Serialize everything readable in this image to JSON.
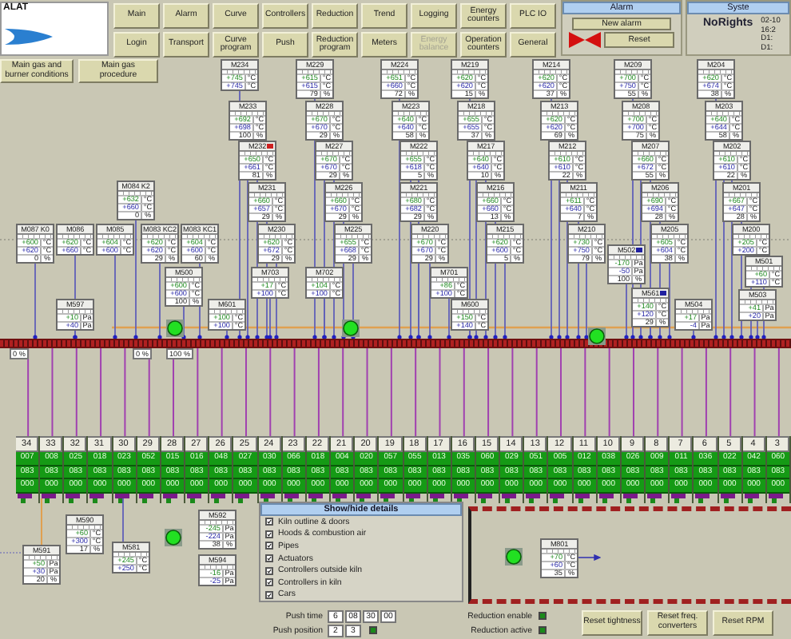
{
  "logo": {
    "text": "ALAT"
  },
  "nav": [
    {
      "label": "Main",
      "disabled": false
    },
    {
      "label": "Alarm",
      "disabled": false
    },
    {
      "label": "Curve",
      "disabled": false
    },
    {
      "label": "Controllers",
      "disabled": false
    },
    {
      "label": "Reduction",
      "disabled": false
    },
    {
      "label": "Trend",
      "disabled": false
    },
    {
      "label": "Logging",
      "disabled": false
    },
    {
      "label": "Energy counters",
      "disabled": false
    },
    {
      "label": "PLC IO",
      "disabled": false
    },
    {
      "label": "Login",
      "disabled": false
    },
    {
      "label": "Transport",
      "disabled": false
    },
    {
      "label": "Curve program",
      "disabled": false
    },
    {
      "label": "Push",
      "disabled": false
    },
    {
      "label": "Reduction program",
      "disabled": false
    },
    {
      "label": "Meters",
      "disabled": false
    },
    {
      "label": "Energy balance",
      "disabled": true
    },
    {
      "label": "Operation counters",
      "disabled": false
    },
    {
      "label": "General",
      "disabled": false
    }
  ],
  "alarm": {
    "title": "Alarm",
    "new_alarm": "New alarm",
    "reset": "Reset"
  },
  "system": {
    "title": "Syste",
    "user": "NoRights",
    "lines": [
      "02-10",
      "16:2",
      "D1:",
      "D1:"
    ]
  },
  "gas_buttons": [
    "Main gas and burner conditions",
    "Main gas procedure"
  ],
  "controllers": [
    {
      "name": "M234",
      "rows": [
        {
          "value": "+745",
          "unit": "°C"
        },
        {
          "value": "+745",
          "unit": "°C"
        }
      ]
    },
    {
      "name": "M229",
      "rows": [
        {
          "value": "+615",
          "unit": "°C"
        },
        {
          "value": "+615",
          "unit": "°C"
        },
        {
          "value": "79",
          "unit": "%"
        }
      ]
    },
    {
      "name": "M224",
      "rows": [
        {
          "value": "+651",
          "unit": "°C"
        },
        {
          "value": "+660",
          "unit": "°C"
        },
        {
          "value": "72",
          "unit": "%"
        }
      ]
    },
    {
      "name": "M219",
      "rows": [
        {
          "value": "+620",
          "unit": "°C"
        },
        {
          "value": "+620",
          "unit": "°C"
        },
        {
          "value": "15",
          "unit": "%"
        }
      ]
    },
    {
      "name": "M214",
      "rows": [
        {
          "value": "+620",
          "unit": "°C"
        },
        {
          "value": "+620",
          "unit": "°C"
        },
        {
          "value": "37",
          "unit": "%"
        }
      ]
    },
    {
      "name": "M209",
      "rows": [
        {
          "value": "+700",
          "unit": "°C"
        },
        {
          "value": "+750",
          "unit": "°C"
        },
        {
          "value": "55",
          "unit": "%"
        }
      ]
    },
    {
      "name": "M204",
      "rows": [
        {
          "value": "+620",
          "unit": "°C"
        },
        {
          "value": "+674",
          "unit": "°C"
        },
        {
          "value": "38",
          "unit": "%"
        }
      ]
    },
    {
      "name": "M233",
      "rows": [
        {
          "value": "+692",
          "unit": "°C"
        },
        {
          "value": "+698",
          "unit": "°C"
        },
        {
          "value": "100",
          "unit": "%"
        }
      ]
    },
    {
      "name": "M228",
      "rows": [
        {
          "value": "+670",
          "unit": "°C"
        },
        {
          "value": "+670",
          "unit": "°C"
        },
        {
          "value": "29",
          "unit": "%"
        }
      ]
    },
    {
      "name": "M223",
      "rows": [
        {
          "value": "+640",
          "unit": "°C"
        },
        {
          "value": "+640",
          "unit": "°C"
        },
        {
          "value": "58",
          "unit": "%"
        }
      ]
    },
    {
      "name": "M218",
      "rows": [
        {
          "value": "+655",
          "unit": "°C"
        },
        {
          "value": "+655",
          "unit": "°C"
        },
        {
          "value": "37",
          "unit": "%"
        }
      ]
    },
    {
      "name": "M213",
      "rows": [
        {
          "value": "+620",
          "unit": "°C"
        },
        {
          "value": "+620",
          "unit": "°C"
        },
        {
          "value": "69",
          "unit": "%"
        }
      ]
    },
    {
      "name": "M208",
      "rows": [
        {
          "value": "+700",
          "unit": "°C"
        },
        {
          "value": "+700",
          "unit": "°C"
        },
        {
          "value": "75",
          "unit": "%"
        }
      ]
    },
    {
      "name": "M203",
      "rows": [
        {
          "value": "+640",
          "unit": "°C"
        },
        {
          "value": "+644",
          "unit": "°C"
        },
        {
          "value": "58",
          "unit": "%"
        }
      ]
    },
    {
      "name": "M232",
      "color": "#cc2020",
      "rows": [
        {
          "value": "+650",
          "unit": "°C"
        },
        {
          "value": "+661",
          "unit": "°C"
        },
        {
          "value": "81",
          "unit": "%"
        }
      ]
    },
    {
      "name": "M227",
      "rows": [
        {
          "value": "+670",
          "unit": "°C"
        },
        {
          "value": "+670",
          "unit": "°C"
        },
        {
          "value": "29",
          "unit": "%"
        }
      ]
    },
    {
      "name": "M222",
      "rows": [
        {
          "value": "+655",
          "unit": "°C"
        },
        {
          "value": "+618",
          "unit": "°C"
        },
        {
          "value": "5",
          "unit": "%"
        }
      ]
    },
    {
      "name": "M217",
      "rows": [
        {
          "value": "+640",
          "unit": "°C"
        },
        {
          "value": "+640",
          "unit": "°C"
        },
        {
          "value": "10",
          "unit": "%"
        }
      ]
    },
    {
      "name": "M212",
      "rows": [
        {
          "value": "+610",
          "unit": "°C"
        },
        {
          "value": "+610",
          "unit": "°C"
        },
        {
          "value": "22",
          "unit": "%"
        }
      ]
    },
    {
      "name": "M207",
      "rows": [
        {
          "value": "+660",
          "unit": "°C"
        },
        {
          "value": "+672",
          "unit": "°C"
        },
        {
          "value": "55",
          "unit": "%"
        }
      ]
    },
    {
      "name": "M202",
      "rows": [
        {
          "value": "+610",
          "unit": "°C"
        },
        {
          "value": "+610",
          "unit": "°C"
        },
        {
          "value": "22",
          "unit": "%"
        }
      ]
    },
    {
      "name": "M084 K2",
      "rows": [
        {
          "value": "+632",
          "unit": "°C"
        },
        {
          "value": "+660",
          "unit": "°C"
        },
        {
          "value": "0",
          "unit": "%"
        }
      ]
    },
    {
      "name": "M231",
      "rows": [
        {
          "value": "+660",
          "unit": "°C"
        },
        {
          "value": "+657",
          "unit": "°C"
        },
        {
          "value": "29",
          "unit": "%"
        }
      ]
    },
    {
      "name": "M226",
      "rows": [
        {
          "value": "+660",
          "unit": "°C"
        },
        {
          "value": "+670",
          "unit": "°C"
        },
        {
          "value": "29",
          "unit": "%"
        }
      ]
    },
    {
      "name": "M221",
      "rows": [
        {
          "value": "+680",
          "unit": "°C"
        },
        {
          "value": "+682",
          "unit": "°C"
        },
        {
          "value": "29",
          "unit": "%"
        }
      ]
    },
    {
      "name": "M216",
      "rows": [
        {
          "value": "+660",
          "unit": "°C"
        },
        {
          "value": "+660",
          "unit": "°C"
        },
        {
          "value": "13",
          "unit": "%"
        }
      ]
    },
    {
      "name": "M211",
      "rows": [
        {
          "value": "+611",
          "unit": "°C"
        },
        {
          "value": "+640",
          "unit": "°C"
        },
        {
          "value": "7",
          "unit": "%"
        }
      ]
    },
    {
      "name": "M206",
      "rows": [
        {
          "value": "+690",
          "unit": "°C"
        },
        {
          "value": "+694",
          "unit": "°C"
        },
        {
          "value": "28",
          "unit": "%"
        }
      ]
    },
    {
      "name": "M201",
      "rows": [
        {
          "value": "+667",
          "unit": "°C"
        },
        {
          "value": "+647",
          "unit": "°C"
        },
        {
          "value": "28",
          "unit": "%"
        }
      ]
    },
    {
      "name": "M087 K0",
      "rows": [
        {
          "value": "+600",
          "unit": "°C"
        },
        {
          "value": "+620",
          "unit": "°C"
        },
        {
          "value": "0",
          "unit": "%"
        }
      ]
    },
    {
      "name": "M086",
      "rows": [
        {
          "value": "+620",
          "unit": "°C"
        },
        {
          "value": "+660",
          "unit": "°C"
        }
      ]
    },
    {
      "name": "M085",
      "rows": [
        {
          "value": "+604",
          "unit": "°C"
        },
        {
          "value": "+600",
          "unit": "°C"
        }
      ]
    },
    {
      "name": "M083 KC2",
      "rows": [
        {
          "value": "+620",
          "unit": "°C"
        },
        {
          "value": "+620",
          "unit": "°C"
        },
        {
          "value": "29",
          "unit": "%"
        }
      ]
    },
    {
      "name": "M083 KC1",
      "rows": [
        {
          "value": "+604",
          "unit": "°C"
        },
        {
          "value": "+600",
          "unit": "°C"
        },
        {
          "value": "60",
          "unit": "%"
        }
      ]
    },
    {
      "name": "M230",
      "rows": [
        {
          "value": "+620",
          "unit": "°C"
        },
        {
          "value": "+672",
          "unit": "°C"
        },
        {
          "value": "29",
          "unit": "%"
        }
      ]
    },
    {
      "name": "M225",
      "rows": [
        {
          "value": "+655",
          "unit": "°C"
        },
        {
          "value": "+668",
          "unit": "°C"
        },
        {
          "value": "29",
          "unit": "%"
        }
      ]
    },
    {
      "name": "M220",
      "rows": [
        {
          "value": "+670",
          "unit": "°C"
        },
        {
          "value": "+670",
          "unit": "°C"
        },
        {
          "value": "29",
          "unit": "%"
        }
      ]
    },
    {
      "name": "M215",
      "rows": [
        {
          "value": "+620",
          "unit": "°C"
        },
        {
          "value": "+600",
          "unit": "°C"
        },
        {
          "value": "5",
          "unit": "%"
        }
      ]
    },
    {
      "name": "M210",
      "rows": [
        {
          "value": "+730",
          "unit": "°C"
        },
        {
          "value": "+750",
          "unit": "°C"
        },
        {
          "value": "79",
          "unit": "%"
        }
      ]
    },
    {
      "name": "M205",
      "rows": [
        {
          "value": "+605",
          "unit": "°C"
        },
        {
          "value": "+604",
          "unit": "°C"
        },
        {
          "value": "38",
          "unit": "%"
        }
      ]
    },
    {
      "name": "M200",
      "rows": [
        {
          "value": "+205",
          "unit": "°C"
        },
        {
          "value": "+200",
          "unit": "°C"
        }
      ]
    },
    {
      "name": "M502",
      "color": "#2020a0",
      "rows": [
        {
          "value": "-170",
          "unit": "Pa"
        },
        {
          "value": "-50",
          "unit": "Pa"
        },
        {
          "value": "100",
          "unit": "%"
        }
      ]
    },
    {
      "name": "M501",
      "rows": [
        {
          "value": "+60",
          "unit": "°C"
        },
        {
          "value": "+110",
          "unit": "°C"
        }
      ]
    },
    {
      "name": "M500",
      "rows": [
        {
          "value": "+600",
          "unit": "°C"
        },
        {
          "value": "+600",
          "unit": "°C"
        },
        {
          "value": "100",
          "unit": "%"
        }
      ]
    },
    {
      "name": "M703",
      "rows": [
        {
          "value": "+17",
          "unit": "°C"
        },
        {
          "value": "+100",
          "unit": "°C"
        }
      ]
    },
    {
      "name": "M702",
      "rows": [
        {
          "value": "+104",
          "unit": "°C"
        },
        {
          "value": "+100",
          "unit": "°C"
        }
      ]
    },
    {
      "name": "M701",
      "rows": [
        {
          "value": "+86",
          "unit": "°C"
        },
        {
          "value": "+100",
          "unit": "°C"
        }
      ]
    },
    {
      "name": "M561",
      "color": "#2020a0",
      "rows": [
        {
          "value": "+140",
          "unit": "°C"
        },
        {
          "value": "+120",
          "unit": "°C"
        },
        {
          "value": "29",
          "unit": "%"
        }
      ]
    },
    {
      "name": "M503",
      "rows": [
        {
          "value": "+41",
          "unit": "Pa"
        },
        {
          "value": "+20",
          "unit": "Pa"
        }
      ]
    },
    {
      "name": "M597",
      "rows": [
        {
          "value": "+10",
          "unit": "Pa"
        },
        {
          "value": "+40",
          "unit": "Pa"
        }
      ]
    },
    {
      "name": "M601",
      "rows": [
        {
          "value": "+100",
          "unit": "°C"
        },
        {
          "value": "+100",
          "unit": "°C"
        }
      ]
    },
    {
      "name": "M600",
      "rows": [
        {
          "value": "+150",
          "unit": "°C"
        },
        {
          "value": "+140",
          "unit": "°C"
        }
      ]
    },
    {
      "name": "M504",
      "rows": [
        {
          "value": "+17",
          "unit": "Pa"
        },
        {
          "value": "-4",
          "unit": "Pa"
        }
      ]
    }
  ],
  "readouts": [
    "0 %",
    "0 %",
    "100 %"
  ],
  "cars": [
    {
      "number": "34",
      "values": [
        "007",
        "083",
        "000"
      ]
    },
    {
      "number": "33",
      "values": [
        "008",
        "083",
        "000"
      ]
    },
    {
      "number": "32",
      "values": [
        "025",
        "083",
        "000"
      ]
    },
    {
      "number": "31",
      "values": [
        "018",
        "083",
        "000"
      ]
    },
    {
      "number": "30",
      "values": [
        "023",
        "083",
        "000"
      ]
    },
    {
      "number": "29",
      "values": [
        "052",
        "083",
        "000"
      ]
    },
    {
      "number": "28",
      "values": [
        "015",
        "083",
        "000"
      ]
    },
    {
      "number": "27",
      "values": [
        "016",
        "083",
        "000"
      ]
    },
    {
      "number": "26",
      "values": [
        "048",
        "083",
        "000"
      ]
    },
    {
      "number": "25",
      "values": [
        "027",
        "083",
        "000"
      ]
    },
    {
      "number": "24",
      "values": [
        "030",
        "083",
        "000"
      ]
    },
    {
      "number": "23",
      "values": [
        "066",
        "083",
        "000"
      ]
    },
    {
      "number": "22",
      "values": [
        "018",
        "083",
        "000"
      ]
    },
    {
      "number": "21",
      "values": [
        "004",
        "083",
        "000"
      ]
    },
    {
      "number": "20",
      "values": [
        "020",
        "083",
        "000"
      ]
    },
    {
      "number": "19",
      "values": [
        "057",
        "083",
        "000"
      ]
    },
    {
      "number": "18",
      "values": [
        "055",
        "083",
        "000"
      ]
    },
    {
      "number": "17",
      "values": [
        "013",
        "083",
        "000"
      ]
    },
    {
      "number": "16",
      "values": [
        "035",
        "083",
        "000"
      ]
    },
    {
      "number": "15",
      "values": [
        "060",
        "083",
        "000"
      ]
    },
    {
      "number": "14",
      "values": [
        "029",
        "083",
        "000"
      ]
    },
    {
      "number": "13",
      "values": [
        "051",
        "083",
        "000"
      ]
    },
    {
      "number": "12",
      "values": [
        "005",
        "083",
        "000"
      ]
    },
    {
      "number": "11",
      "values": [
        "012",
        "083",
        "000"
      ]
    },
    {
      "number": "10",
      "values": [
        "038",
        "083",
        "000"
      ]
    },
    {
      "number": "9",
      "values": [
        "026",
        "083",
        "000"
      ]
    },
    {
      "number": "8",
      "values": [
        "009",
        "083",
        "000"
      ]
    },
    {
      "number": "7",
      "values": [
        "011",
        "083",
        "000"
      ]
    },
    {
      "number": "6",
      "values": [
        "036",
        "083",
        "000"
      ]
    },
    {
      "number": "5",
      "values": [
        "022",
        "083",
        "000"
      ]
    },
    {
      "number": "4",
      "values": [
        "042",
        "083",
        "000"
      ]
    },
    {
      "number": "3",
      "values": [
        "060",
        "083",
        "000"
      ]
    }
  ],
  "lower_controllers": [
    {
      "name": "M590",
      "rows": [
        {
          "value": "+60",
          "unit": "°C"
        },
        {
          "value": "+300",
          "unit": "°C"
        },
        {
          "value": "17",
          "unit": "%"
        }
      ]
    },
    {
      "name": "M592",
      "rows": [
        {
          "value": "-245",
          "unit": "Pa"
        },
        {
          "value": "-224",
          "unit": "Pa"
        },
        {
          "value": "38",
          "unit": "%"
        }
      ]
    },
    {
      "name": "M591",
      "rows": [
        {
          "value": "+50",
          "unit": "Pa"
        },
        {
          "value": "+30",
          "unit": "Pa"
        },
        {
          "value": "20",
          "unit": "%"
        }
      ]
    },
    {
      "name": "M581",
      "rows": [
        {
          "value": "+245",
          "unit": "°C"
        },
        {
          "value": "+250",
          "unit": "°C"
        }
      ]
    },
    {
      "name": "M594",
      "rows": [
        {
          "value": "-16",
          "unit": "Pa"
        },
        {
          "value": "-25",
          "unit": "Pa"
        }
      ]
    }
  ],
  "details": {
    "title": "Show/hide details",
    "items": [
      {
        "label": "Kiln outline & doors",
        "checked": true
      },
      {
        "label": "Hoods & combustion air",
        "checked": true
      },
      {
        "label": "Pipes",
        "checked": true
      },
      {
        "label": "Actuators",
        "checked": true
      },
      {
        "label": "Controllers outside kiln",
        "checked": true
      },
      {
        "label": "Controllers in kiln",
        "checked": true
      },
      {
        "label": "Cars",
        "checked": true
      }
    ]
  },
  "reduction_controllers": [
    {
      "name": "M801",
      "rows": [
        {
          "value": "+70",
          "unit": "°C"
        },
        {
          "value": "+60",
          "unit": "°C"
        },
        {
          "value": "35",
          "unit": "%"
        }
      ]
    }
  ],
  "push_time": {
    "label": "Push time",
    "fields": [
      "6",
      "08",
      "30",
      "00"
    ]
  },
  "push_position": {
    "label": "Push position",
    "fields": [
      "2",
      "3"
    ],
    "on": true
  },
  "indicators": [
    {
      "label": "Reduction enable",
      "on": true
    },
    {
      "label": "Reduction active",
      "on": true
    }
  ],
  "reset_buttons": [
    "Reset tightness",
    "Reset freq. converters",
    "Reset RPM"
  ]
}
